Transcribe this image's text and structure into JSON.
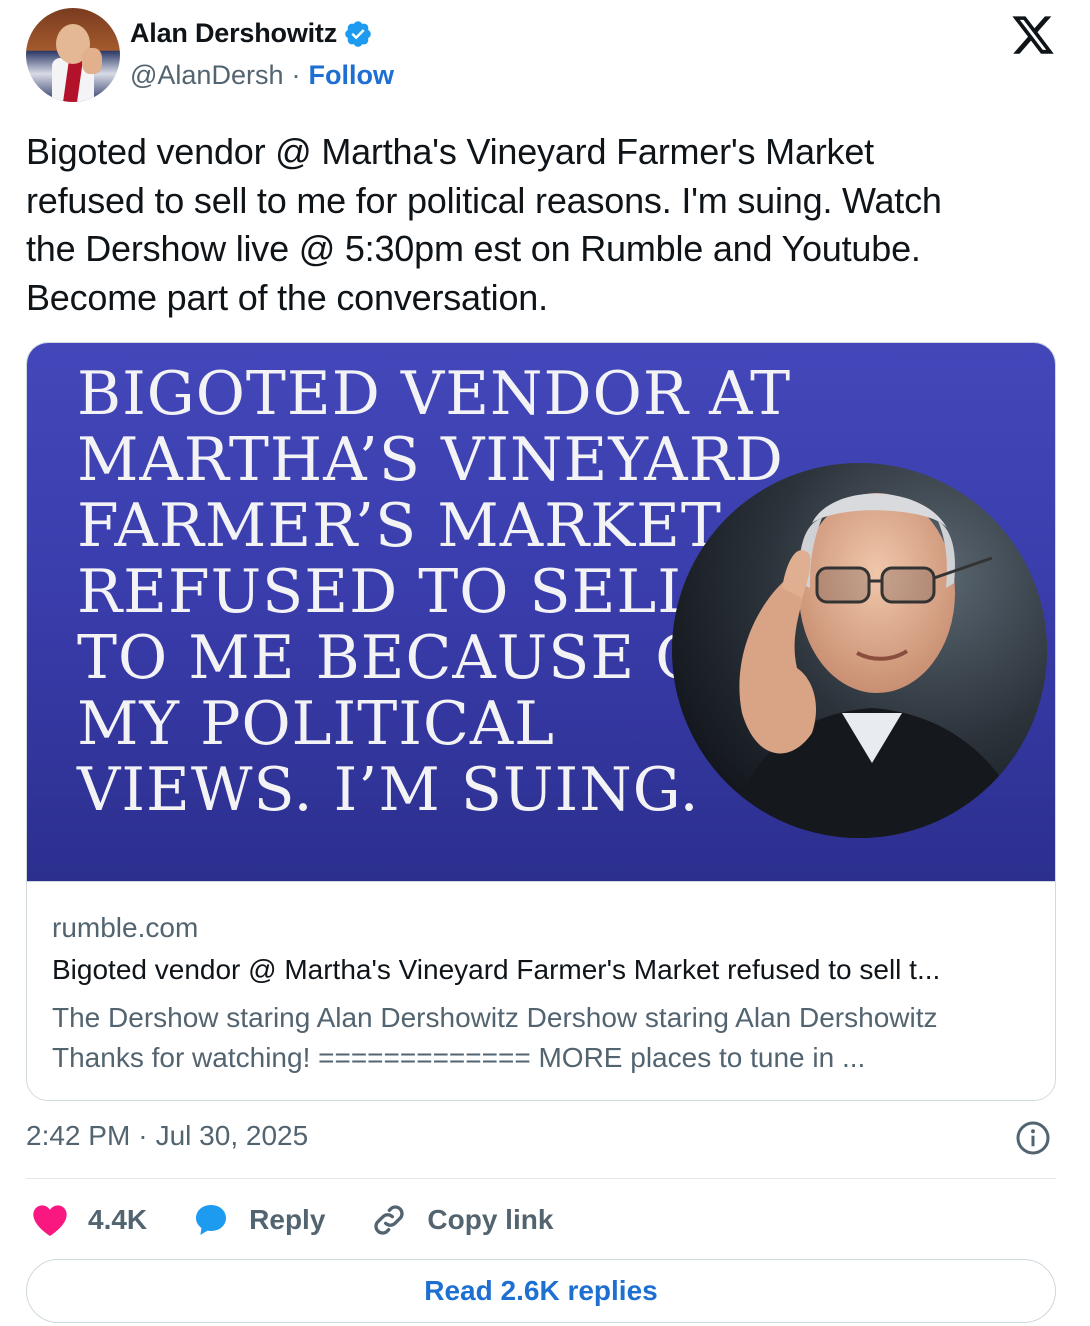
{
  "author": {
    "display_name": "Alan Dershowitz",
    "handle": "@AlanDersh",
    "separator": "·",
    "follow_label": "Follow"
  },
  "tweet": {
    "text": "Bigoted vendor @ Martha's Vineyard Farmer's Market\nrefused to sell to me for political reasons. I'm suing. Watch\nthe Dershow live @ 5:30pm est on Rumble and Youtube.\nBecome part of the conversation."
  },
  "card": {
    "headline_lines": [
      "BIGOTED VENDOR AT",
      "MARTHA’S VINEYARD",
      "FARMER’S MARKET",
      "REFUSED TO SELL",
      "TO ME BECAUSE OF",
      "MY POLITICAL",
      "VIEWS. I’M SUING."
    ],
    "domain": "rumble.com",
    "title": "Bigoted vendor @ Martha's Vineyard Farmer's Market refused to sell t...",
    "description_line1": "The Dershow staring Alan Dershowitz Dershow staring Alan Dershowitz",
    "description_line2": "Thanks for watching! ============= MORE places to tune in ..."
  },
  "meta": {
    "time": "2:42 PM",
    "separator": "·",
    "date": "Jul 30, 2025"
  },
  "actions": {
    "likes": "4.4K",
    "reply_label": "Reply",
    "copy_label": "Copy link"
  },
  "read_replies_label": "Read 2.6K replies",
  "colors": {
    "accent": "#1d6fd1",
    "like": "#f91880",
    "reply": "#1d9bf0",
    "card_bg": "#3a3dac"
  },
  "icons": [
    "verified-badge-icon",
    "x-logo-icon",
    "info-icon",
    "heart-icon",
    "reply-bubble-icon",
    "link-icon"
  ]
}
